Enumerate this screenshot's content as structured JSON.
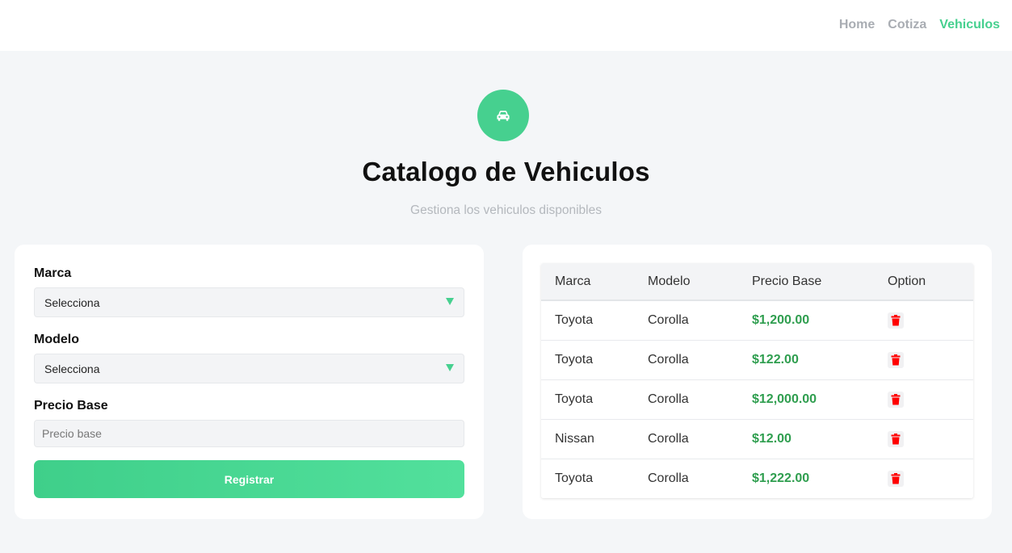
{
  "nav": {
    "items": [
      {
        "label": "Home",
        "active": false
      },
      {
        "label": "Cotiza",
        "active": false
      },
      {
        "label": "Vehiculos",
        "active": true
      }
    ]
  },
  "header": {
    "icon": "car-icon",
    "title": "Catalogo de Vehiculos",
    "subtitle": "Gestiona los vehiculos disponibles"
  },
  "form": {
    "marca_label": "Marca",
    "marca_value": "Selecciona",
    "modelo_label": "Modelo",
    "modelo_value": "Selecciona",
    "precio_label": "Precio Base",
    "precio_placeholder": "Precio base",
    "submit_label": "Registrar"
  },
  "table": {
    "headers": [
      "Marca",
      "Modelo",
      "Precio Base",
      "Option"
    ],
    "rows": [
      {
        "marca": "Toyota",
        "modelo": "Corolla",
        "precio": "$1,200.00"
      },
      {
        "marca": "Toyota",
        "modelo": "Corolla",
        "precio": "$122.00"
      },
      {
        "marca": "Toyota",
        "modelo": "Corolla",
        "precio": "$12,000.00"
      },
      {
        "marca": "Nissan",
        "modelo": "Corolla",
        "precio": "$12.00"
      },
      {
        "marca": "Toyota",
        "modelo": "Corolla",
        "precio": "$1,222.00"
      }
    ],
    "delete_icon": "trash-icon"
  },
  "colors": {
    "accent": "#46d08f",
    "price": "#2f9e4f",
    "delete": "#ff0000"
  }
}
